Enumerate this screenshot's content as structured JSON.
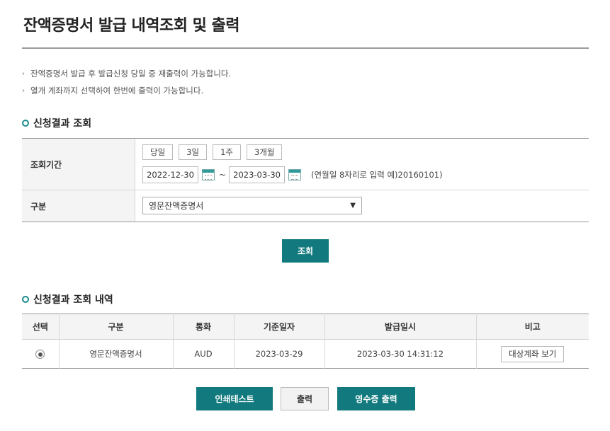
{
  "page": {
    "title": "잔액증명서 발급 내역조회 및 출력"
  },
  "notes": [
    "잔액증명서 발급 후 발급신청 당일 중 재출력이 가능합니다.",
    "열개 계좌까지 선택하여 한번에 출력이 가능합니다."
  ],
  "search_section": {
    "title": "신청결과 조회",
    "period_label": "조회기간",
    "quick_buttons": [
      "당일",
      "3일",
      "1주",
      "3개월"
    ],
    "date_from": "2022-12-30",
    "date_separator": "~",
    "date_to": "2023-03-30",
    "date_hint": "(연월일 8자리로 입력 예)20160101)",
    "kind_label": "구분",
    "kind_selected": "영문잔액증명서",
    "search_button": "조회"
  },
  "result_section": {
    "title": "신청결과 조회 내역",
    "columns": [
      "선택",
      "구분",
      "통화",
      "기준일자",
      "발급일시",
      "비고"
    ],
    "rows": [
      {
        "selected": true,
        "kind": "영문잔액증명서",
        "currency": "AUD",
        "base_date": "2023-03-29",
        "issued_at": "2023-03-30 14:31:12",
        "remark_button": "대상계좌 보기"
      }
    ]
  },
  "actions": {
    "print_test": "인쇄테스트",
    "print": "출력",
    "receipt_print": "영수증 출력"
  },
  "colors": {
    "accent": "#127a7e",
    "header_bg": "#f4f4f4"
  }
}
